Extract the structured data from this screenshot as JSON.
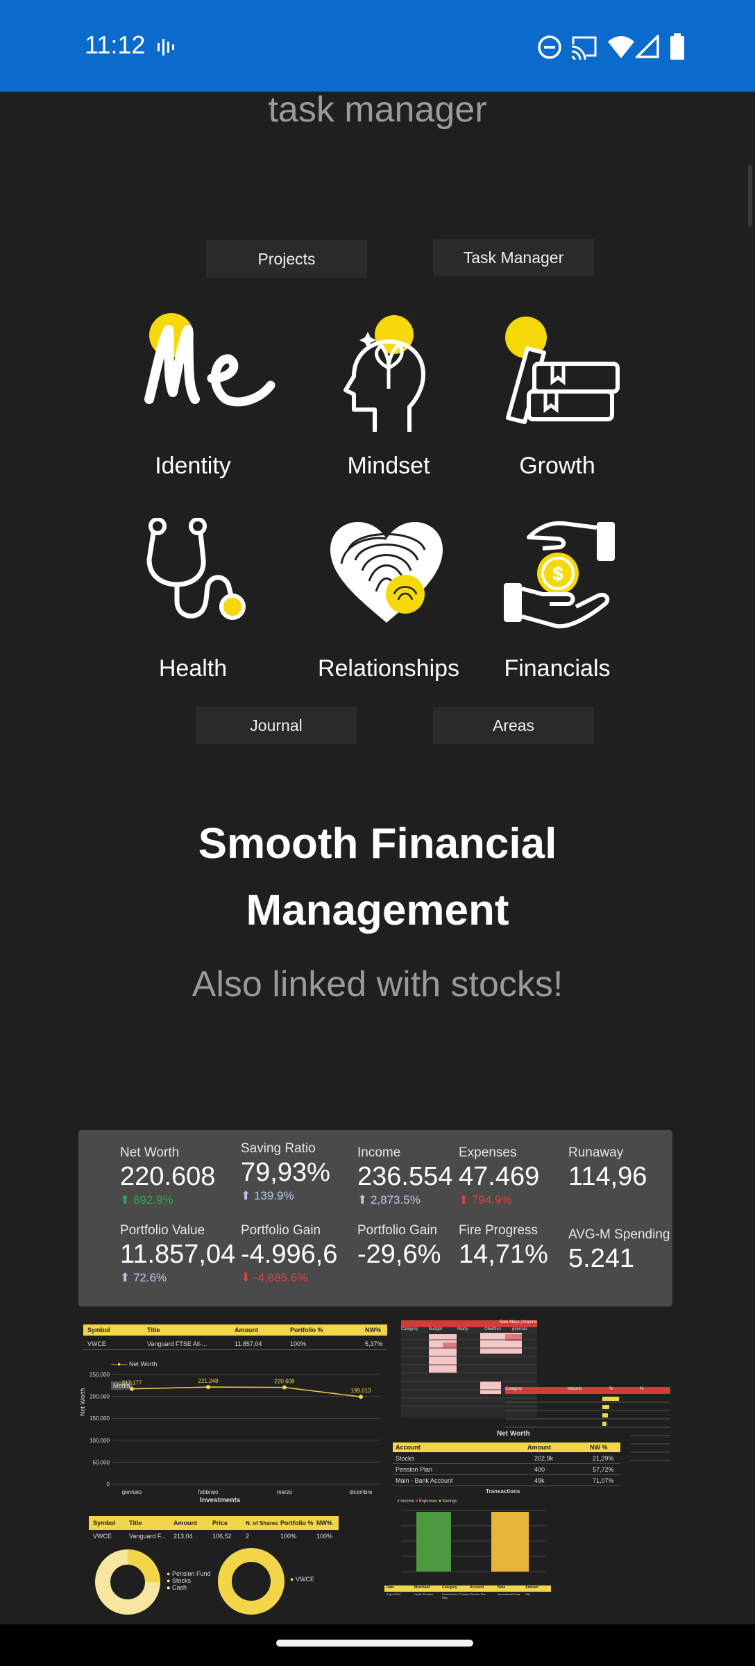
{
  "status_bar": {
    "time": "11:12",
    "icons": [
      "voicemail-icon",
      "dnd-icon",
      "cast-icon",
      "wifi-icon",
      "signal-icon",
      "battery-icon"
    ]
  },
  "page": {
    "title": "task manager"
  },
  "nav_top": {
    "projects": "Projects",
    "task_manager": "Task Manager"
  },
  "areas": [
    {
      "label": "Identity",
      "icon": "me-icon"
    },
    {
      "label": "Mindset",
      "icon": "head-plant-icon"
    },
    {
      "label": "Growth",
      "icon": "books-icon"
    },
    {
      "label": "Health",
      "icon": "stethoscope-icon"
    },
    {
      "label": "Relationships",
      "icon": "fingerprint-heart-icon"
    },
    {
      "label": "Financials",
      "icon": "hands-coin-icon"
    }
  ],
  "nav_bottom": {
    "journal": "Journal",
    "areas": "Areas"
  },
  "hero": {
    "line1": "Smooth Financial",
    "line2": "Management",
    "subtitle": "Also linked with stocks!"
  },
  "kpis": [
    {
      "label": "Net Worth",
      "value": "220.608",
      "delta": "692.9%",
      "trend": "up"
    },
    {
      "label": "Saving Ratio",
      "value": "79,93%",
      "delta": "139.9%",
      "trend": "up"
    },
    {
      "label": "Income",
      "value": "236.554",
      "delta": "2,873.5%",
      "trend": "up"
    },
    {
      "label": "Expenses",
      "value": "47.469",
      "delta": "794.9%",
      "trend": "up-bad"
    },
    {
      "label": "Runaway",
      "value": "114,96",
      "delta": "",
      "trend": ""
    },
    {
      "label": "Portfolio Value",
      "value": "11.857,04",
      "delta": "72.6%",
      "trend": "up"
    },
    {
      "label": "Portfolio Gain",
      "value": "-4.996,6",
      "delta": "-4,885.6%",
      "trend": "down"
    },
    {
      "label": "Portfolio Gain",
      "value": "-29,6%",
      "delta": "",
      "trend": ""
    },
    {
      "label": "Fire Progress",
      "value": "14,71%",
      "delta": "",
      "trend": ""
    },
    {
      "label": "AVG-M Spending",
      "value": "5.241",
      "delta": "",
      "trend": ""
    }
  ],
  "stocks_table": {
    "headers": [
      "Symbol",
      "Title",
      "Amount",
      "Portfolio %",
      "NW%"
    ],
    "row": [
      "VWCE",
      "Vanguard FTSE All-...",
      "11.857,04",
      "100%",
      "5,37%"
    ]
  },
  "networth_chart": {
    "legend": "Net Worth",
    "tooltip": "Media",
    "yticks": [
      "250.000",
      "200.000",
      "150.000",
      "100.000",
      "50.000",
      "0"
    ],
    "ylabel": "Net Worth",
    "categories": [
      "gennaio",
      "febbraio",
      "marzo",
      "dicembre"
    ],
    "point_labels": [
      "217.177",
      "221.248",
      "220.608",
      "199.013"
    ]
  },
  "chart_data": {
    "type": "line",
    "title": "",
    "xlabel": "",
    "ylabel": "Net Worth",
    "categories": [
      "gennaio",
      "febbraio",
      "marzo",
      "dicembre"
    ],
    "series": [
      {
        "name": "Net Worth",
        "values": [
          217177,
          221248,
          220608,
          199013
        ]
      }
    ],
    "ylim": [
      0,
      250000
    ]
  },
  "investments": {
    "title": "Investments",
    "headers": [
      "Symbol",
      "Title",
      "Amount",
      "Price",
      "N. of Shares",
      "Portfolio %",
      "NW%"
    ],
    "row": [
      "VWCE",
      "Vanguard F...",
      "213,04",
      "106,52",
      "2",
      "100%",
      "100%"
    ],
    "donut1_legend": [
      "Pension Fund",
      "Stocks",
      "Cash"
    ],
    "donut2_legend": [
      "VWCE"
    ]
  },
  "budget_table": {
    "header_right": "Rata Mese | Importo",
    "cols": [
      "Category",
      "Budget",
      "Yearly",
      "Obiettivo",
      "gennaio"
    ]
  },
  "expense_table": {
    "cols": [
      "Category",
      "Importo",
      "%",
      "%"
    ]
  },
  "networth_table": {
    "title": "Net Worth",
    "headers": [
      "Account",
      "Amount",
      "NW %"
    ],
    "rows": [
      [
        "Stocks",
        "202,9k",
        "21,29%"
      ],
      [
        "Pension Plan",
        "400",
        "57,72%"
      ],
      [
        "Main - Bank Account",
        "49k",
        "71,07%"
      ]
    ]
  },
  "transactions": {
    "title": "Transactions",
    "legend": [
      "Income",
      "Expenses",
      "Savings"
    ],
    "footer_cols": [
      "Date",
      "Merchant",
      "Category",
      "Account",
      "Note",
      "Amount"
    ],
    "footer_row": [
      "8 gen 2024",
      "Health Pension",
      "Investments / Pension Plan",
      "Pension Plan",
      "International Fund",
      "400"
    ]
  },
  "colors": {
    "status_bar": "#0a6bcc",
    "background": "#1f1f1f",
    "accent_yellow": "#f5d90a",
    "card": "#4a4a4a"
  }
}
